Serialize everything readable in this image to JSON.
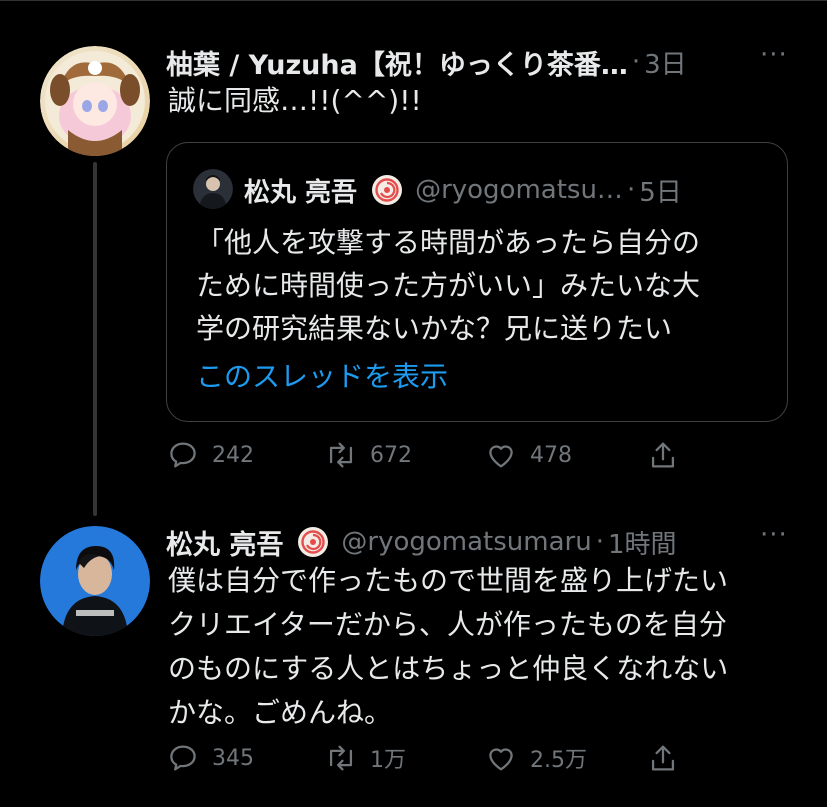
{
  "thread": [
    {
      "author": "柚葉 / Yuzuha【祝！ゆっくり茶番…",
      "time": "3日",
      "more": "···",
      "lines": [
        "誠に同感…!!(^^)!!"
      ],
      "avatar_icon": "anime-character-avatar-icon",
      "quoted": {
        "author": "松丸 亮吾",
        "handle": "@ryogomatsu…",
        "time": "5日",
        "lines": [
          "「他人を攻撃する時間があったら自分の",
          "ために時間使った方がいい」みたいな大",
          "学の研究結果ないかな？兄に送りたい"
        ],
        "show_thread": "このスレッドを表示"
      },
      "counts": {
        "replies": "242",
        "retweets": "672",
        "likes": "478"
      }
    },
    {
      "author": "松丸 亮吾",
      "handle": "@ryogomatsumaru",
      "time": "1時間",
      "more": "···",
      "lines": [
        "僕は自分で作ったもので世間を盛り上げたい",
        "クリエイターだから、人が作ったものを自分",
        "のものにする人とはちょっと仲良くなれない",
        "かな。ごめんね。"
      ],
      "avatar_icon": "person-photo-avatar-icon",
      "counts": {
        "replies": "345",
        "retweets": "1万",
        "likes": "2.5万"
      }
    }
  ],
  "colors": {
    "background": "#000000",
    "text": "#e7e9ea",
    "muted": "#71767b",
    "link": "#1d9bf0",
    "border": "#3e4144"
  }
}
